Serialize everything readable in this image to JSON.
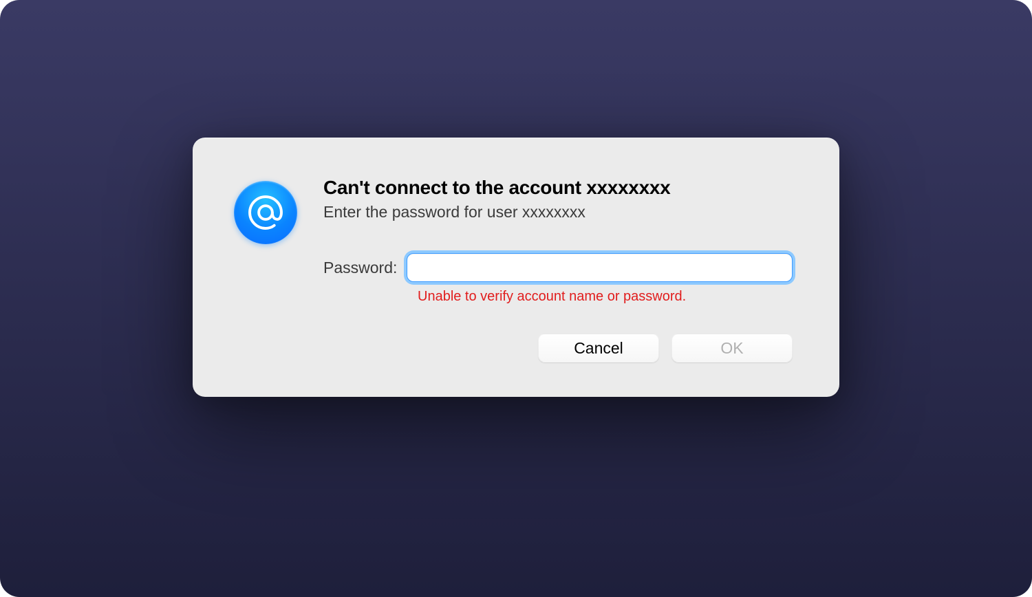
{
  "dialog": {
    "title": "Can't connect to the account xxxxxxxx",
    "subtitle": "Enter the password for user xxxxxxxx",
    "field_label": "Password:",
    "password_value": "",
    "password_placeholder": "",
    "error": "Unable to verify account name or password.",
    "cancel_label": "Cancel",
    "ok_label": "OK",
    "ok_enabled": false
  },
  "icons": {
    "app_icon_name": "at-sign-icon"
  }
}
